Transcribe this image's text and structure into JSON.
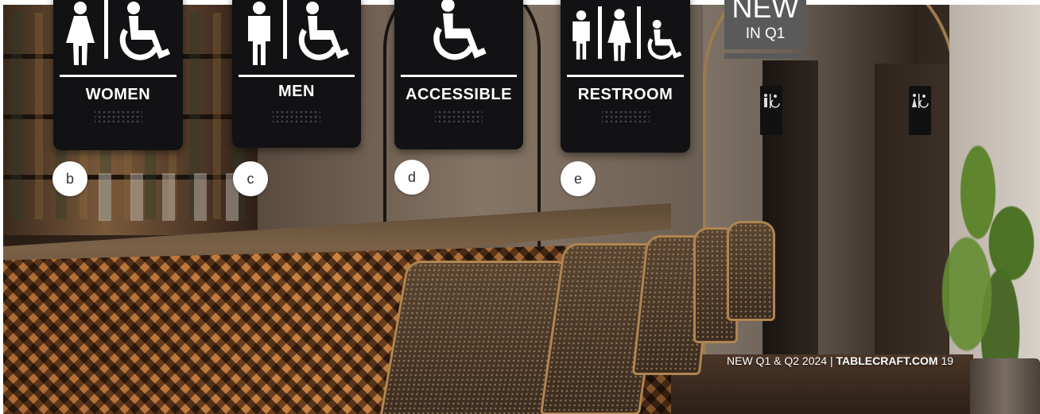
{
  "signs": [
    {
      "id": "b",
      "label": "WOMEN",
      "icons": [
        "woman-icon",
        "wheelchair-icon"
      ]
    },
    {
      "id": "c",
      "label": "MEN",
      "icons": [
        "man-icon",
        "wheelchair-icon"
      ]
    },
    {
      "id": "d",
      "label": "ACCESSIBLE",
      "icons": [
        "wheelchair-icon"
      ]
    },
    {
      "id": "e",
      "label": "RESTROOM",
      "icons": [
        "man-icon",
        "woman-icon",
        "wheelchair-icon"
      ]
    }
  ],
  "callouts": [
    "b",
    "c",
    "d",
    "e"
  ],
  "badge": {
    "line1": "NEW",
    "line2": "IN Q1"
  },
  "footer": {
    "edition": "NEW Q1 & Q2 2024 | ",
    "site": "TABLECRAFT.COM",
    "page": "19"
  },
  "colors": {
    "sign_bg": "#121214",
    "badge_bg": "#5b5a5a",
    "callout_bg": "#ffffff"
  }
}
